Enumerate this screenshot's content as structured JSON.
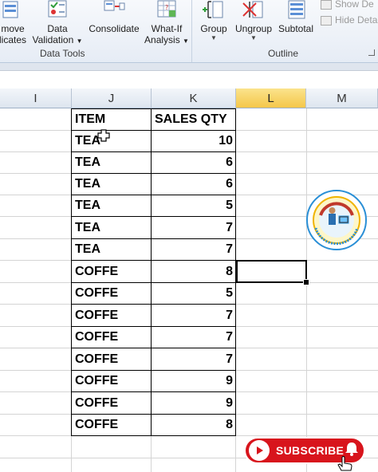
{
  "ribbon": {
    "remove_duplicates": "move\nlicates",
    "remove_duplicates_line1": "move",
    "remove_duplicates_line2": "licates",
    "data_validation_line1": "Data",
    "data_validation_line2": "Validation",
    "consolidate": "Consolidate",
    "whatif_line1": "What-If",
    "whatif_line2": "Analysis",
    "group": "Group",
    "ungroup": "Ungroup",
    "subtotal": "Subtotal",
    "show_detail": "Show De",
    "hide_detail": "Hide Deta",
    "group_label_data_tools": "Data Tools",
    "group_label_outline": "Outline"
  },
  "columns": {
    "i": "I",
    "j": "J",
    "k": "K",
    "l": "L",
    "m": "M"
  },
  "table": {
    "header_item": "ITEM",
    "header_qty": "SALES QTY",
    "rows": [
      {
        "item": "TEA",
        "qty": "10"
      },
      {
        "item": "TEA",
        "qty": "6"
      },
      {
        "item": "TEA",
        "qty": "6"
      },
      {
        "item": "TEA",
        "qty": "5"
      },
      {
        "item": "TEA",
        "qty": "7"
      },
      {
        "item": "TEA",
        "qty": "7"
      },
      {
        "item": "COFFE",
        "qty": "8"
      },
      {
        "item": "COFFE",
        "qty": "5"
      },
      {
        "item": "COFFE",
        "qty": "7"
      },
      {
        "item": "COFFE",
        "qty": "7"
      },
      {
        "item": "COFFE",
        "qty": "7"
      },
      {
        "item": "COFFE",
        "qty": "9"
      },
      {
        "item": "COFFE",
        "qty": "9"
      },
      {
        "item": "COFFE",
        "qty": "8"
      }
    ]
  },
  "logo": {
    "ring_text": "THIRST TO SUCCESS AND TECHNOLOGY APPLICATION OF OUR WEBSITE",
    "name": "GYAN PC STUDY"
  },
  "subscribe": {
    "label": "SUBSCRIBE"
  },
  "colors": {
    "selected_column_header": "#f4c74a",
    "subscribe_red": "#d8141c",
    "gridline": "#d4d4d4"
  }
}
